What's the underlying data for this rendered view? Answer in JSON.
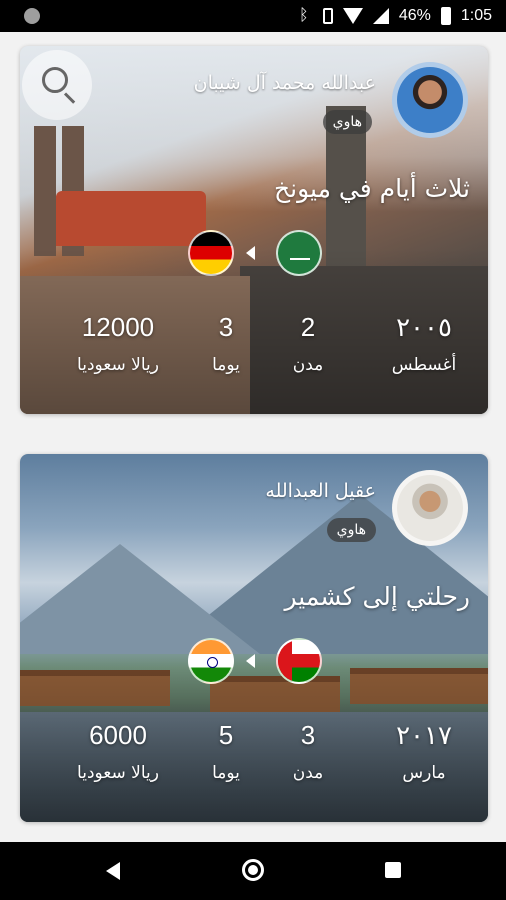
{
  "status_bar": {
    "battery": "46%",
    "time": "1:05",
    "icons": [
      "bluetooth-icon",
      "vibrate-icon",
      "wifi-icon",
      "signal-icon",
      "battery-icon"
    ]
  },
  "trips": [
    {
      "user_name": "عبدالله محمد آل شيبان",
      "hobby": "هاوي",
      "title": "ثلاث أيام في ميونخ",
      "from_flag": "saudi-arabia-flag",
      "to_flag": "germany-flag",
      "date_value": "٢٠٠٥",
      "date_label": "أغسطس",
      "cities_value": "2",
      "cities_label": "مدن",
      "days_value": "3",
      "days_label": "يوما",
      "budget_value": "12000",
      "budget_label": "ريالا سعوديا"
    },
    {
      "user_name": "عقيل العبدالله",
      "hobby": "هاوي",
      "title": "رحلتي إلى كشمير",
      "from_flag": "oman-flag",
      "to_flag": "india-flag",
      "date_value": "٢٠١٧",
      "date_label": "مارس",
      "cities_value": "3",
      "cities_label": "مدن",
      "days_value": "5",
      "days_label": "يوما",
      "budget_value": "6000",
      "budget_label": "ريالا سعوديا"
    }
  ],
  "colors": {
    "status_bar": "#000000",
    "background": "#f2f2f2",
    "nav_bar": "#000000"
  }
}
